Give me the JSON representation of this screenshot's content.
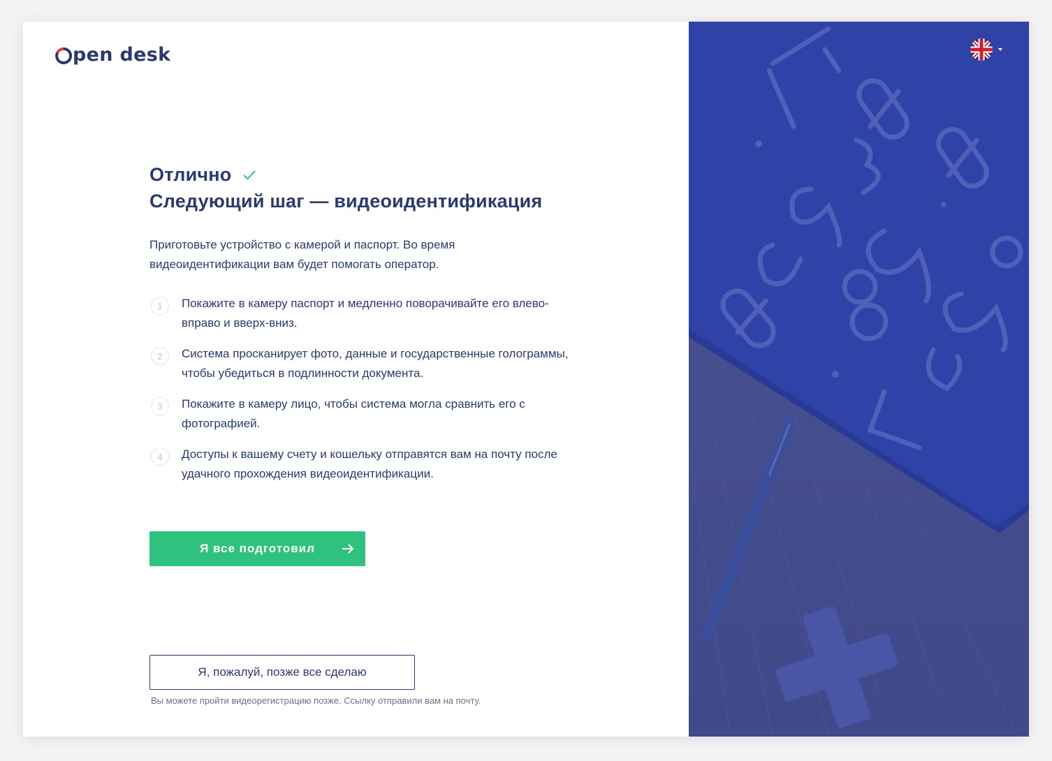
{
  "brand": {
    "logo_text": "pen desk",
    "colors": {
      "navy": "#2b3a6a",
      "red": "#e0393e",
      "green": "#2ec27e",
      "panel": "#454f8e"
    }
  },
  "language": {
    "flag_icon": "uk-flag-icon",
    "dropdown_icon": "caret-down-icon"
  },
  "main": {
    "title_line1": "Отлично",
    "title_line2": "Следующий шаг — видеоидентификация",
    "intro": "Приготовьте устройство с камерой и паспорт. Во время видеоидентификации вам будет помогать оператор.",
    "steps": [
      {
        "num": "1",
        "text": "Покажите в камеру паспорт и медленно поворачивайте его влево-вправо и вверх-вниз."
      },
      {
        "num": "2",
        "text": "Система просканирует фото, данные и государственные голограммы, чтобы убедиться в подлинности документа."
      },
      {
        "num": "3",
        "text": "Покажите в камеру лицо, чтобы система могла сравнить его с фотографией."
      },
      {
        "num": "4",
        "text": "Доступы к вашему счету и кошельку отправятся вам на почту после удачного прохождения видеоидентификации."
      }
    ],
    "primary_button": "Я все подготовил",
    "secondary_button": "Я, пожалуй, позже все сделаю",
    "note": "Вы можете пройти видеорегистрацию позже. Ссылку отправили вам на почту."
  }
}
